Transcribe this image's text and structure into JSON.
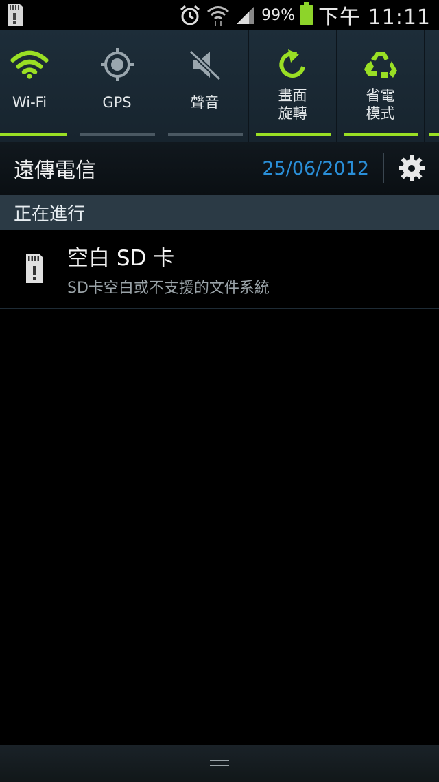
{
  "status_bar": {
    "battery_percent": "99%",
    "time": "下午 11:11",
    "icons": [
      "sd-card-icon",
      "alarm-icon",
      "wifi-icon",
      "signal-icon",
      "battery-icon"
    ]
  },
  "quick_settings": [
    {
      "label": "Wi-Fi",
      "icon": "wifi-icon",
      "active": true
    },
    {
      "label": "GPS",
      "icon": "gps-icon",
      "active": false
    },
    {
      "label": "聲音",
      "icon": "sound-off-icon",
      "active": false
    },
    {
      "label": "畫面\n旋轉",
      "icon": "rotate-icon",
      "active": true
    },
    {
      "label": "省電\n模式",
      "icon": "recycle-icon",
      "active": true
    }
  ],
  "carrier": {
    "name": "遠傳電信",
    "date": "25/06/2012"
  },
  "section": {
    "title": "正在進行"
  },
  "notification": {
    "title": "空白 SD 卡",
    "subtitle": "SD卡空白或不支援的文件系統"
  },
  "colors": {
    "accent": "#9adf24",
    "date": "#2a8fd8",
    "section_bg": "#2b3a45"
  }
}
